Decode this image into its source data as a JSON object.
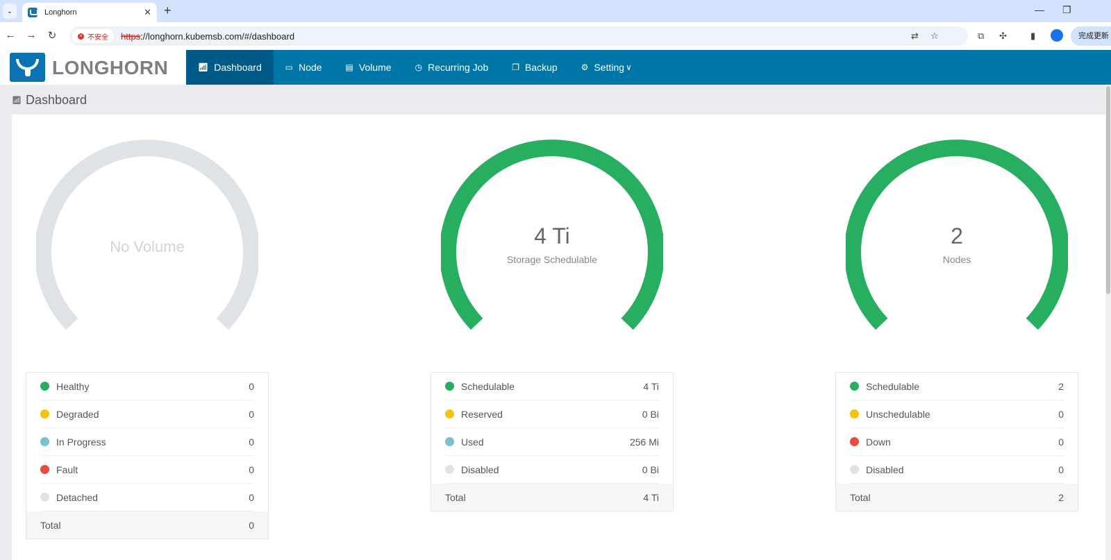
{
  "browser": {
    "tab_title": "Longhorn",
    "url_scheme": "https",
    "url_rest": "://longhorn.kubemsb.com/#/dashboard",
    "security_label": "不安全",
    "update_label": "完成更新"
  },
  "header": {
    "logo_text": "LONGHORN",
    "nav": [
      {
        "label": "Dashboard",
        "icon": "bar-chart-icon"
      },
      {
        "label": "Node",
        "icon": "laptop-icon"
      },
      {
        "label": "Volume",
        "icon": "document-icon"
      },
      {
        "label": "Recurring Job",
        "icon": "clock-icon"
      },
      {
        "label": "Backup",
        "icon": "copy-icon"
      },
      {
        "label": "Setting",
        "icon": "gear-icon"
      }
    ]
  },
  "page": {
    "title": "Dashboard"
  },
  "colors": {
    "brand": "#0075a8",
    "active_nav": "#005a87",
    "green": "#27ae60",
    "yellow": "#f1c40f",
    "teal": "#78c2d0",
    "red": "#e74c3c",
    "gray": "#dfe2e6"
  },
  "volumes": {
    "gauge_text": "No Volume",
    "rows": [
      {
        "label": "Healthy",
        "value": "0",
        "color": "#27ae60"
      },
      {
        "label": "Degraded",
        "value": "0",
        "color": "#f1c40f"
      },
      {
        "label": "In Progress",
        "value": "0",
        "color": "#78c2d0"
      },
      {
        "label": "Fault",
        "value": "0",
        "color": "#e74c3c"
      },
      {
        "label": "Detached",
        "value": "0",
        "color": "#dfe2e6"
      }
    ],
    "total_label": "Total",
    "total_value": "0"
  },
  "storage": {
    "gauge_value": "4 Ti",
    "gauge_label": "Storage Schedulable",
    "rows": [
      {
        "label": "Schedulable",
        "value": "4 Ti",
        "color": "#27ae60"
      },
      {
        "label": "Reserved",
        "value": "0 Bi",
        "color": "#f1c40f"
      },
      {
        "label": "Used",
        "value": "256 Mi",
        "color": "#78c2d0"
      },
      {
        "label": "Disabled",
        "value": "0 Bi",
        "color": "#dfe2e6"
      }
    ],
    "total_label": "Total",
    "total_value": "4 Ti"
  },
  "nodes": {
    "gauge_value": "2",
    "gauge_label": "Nodes",
    "rows": [
      {
        "label": "Schedulable",
        "value": "2",
        "color": "#27ae60"
      },
      {
        "label": "Unschedulable",
        "value": "0",
        "color": "#f1c40f"
      },
      {
        "label": "Down",
        "value": "0",
        "color": "#e74c3c"
      },
      {
        "label": "Disabled",
        "value": "0",
        "color": "#dfe2e6"
      }
    ],
    "total_label": "Total",
    "total_value": "2"
  }
}
